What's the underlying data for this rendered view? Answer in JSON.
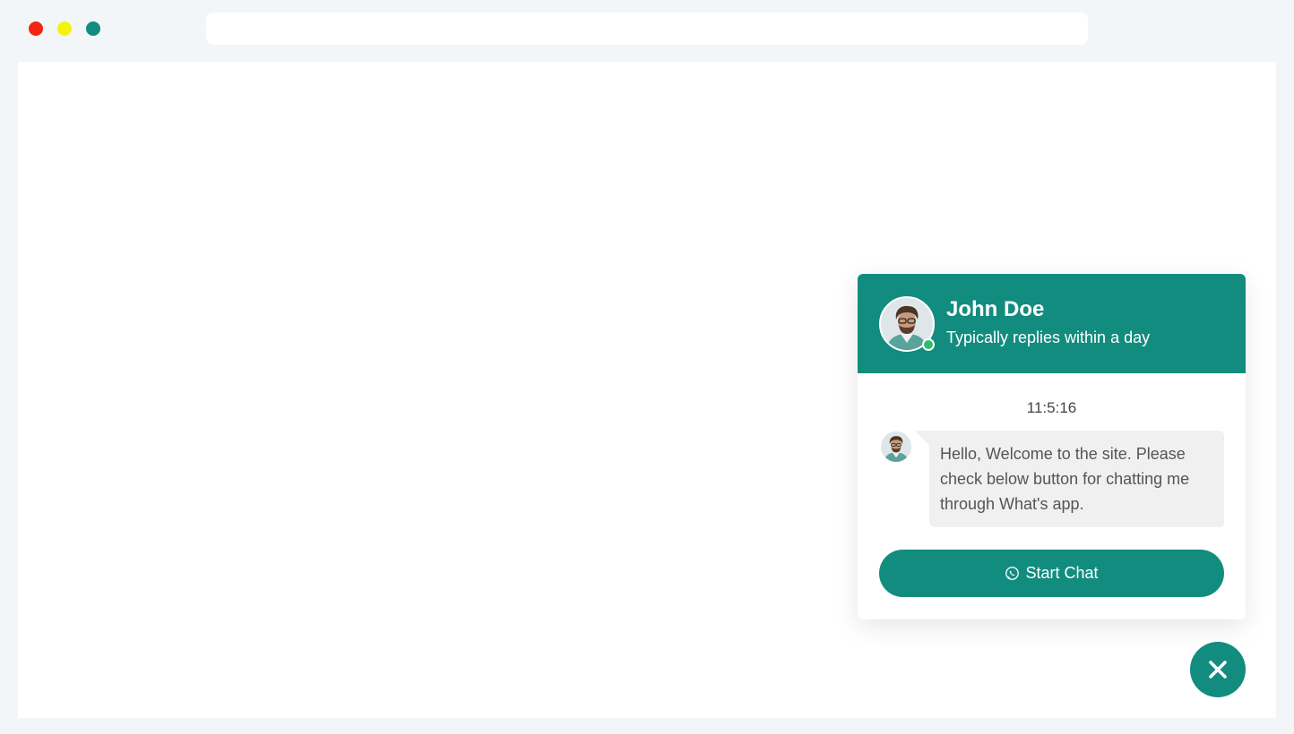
{
  "browser": {
    "address_bar_value": "",
    "colors": {
      "close_dot": "#f02611",
      "minimize_dot": "#f5f20b",
      "maximize_dot": "#128c7e"
    }
  },
  "chat_widget": {
    "accent_color": "#128c7e",
    "header": {
      "agent_name": "John Doe",
      "agent_status": "Typically replies within a day",
      "avatar_icon": "agent-avatar",
      "online_indicator_color": "#2bbf6a"
    },
    "body": {
      "timestamp": "11:5:16",
      "message": "Hello, Welcome to the site. Please check below button for chatting me through What's app."
    },
    "start_chat_button": {
      "label": "Start Chat",
      "icon": "whatsapp-icon"
    }
  },
  "close_button": {
    "icon": "close-icon"
  }
}
